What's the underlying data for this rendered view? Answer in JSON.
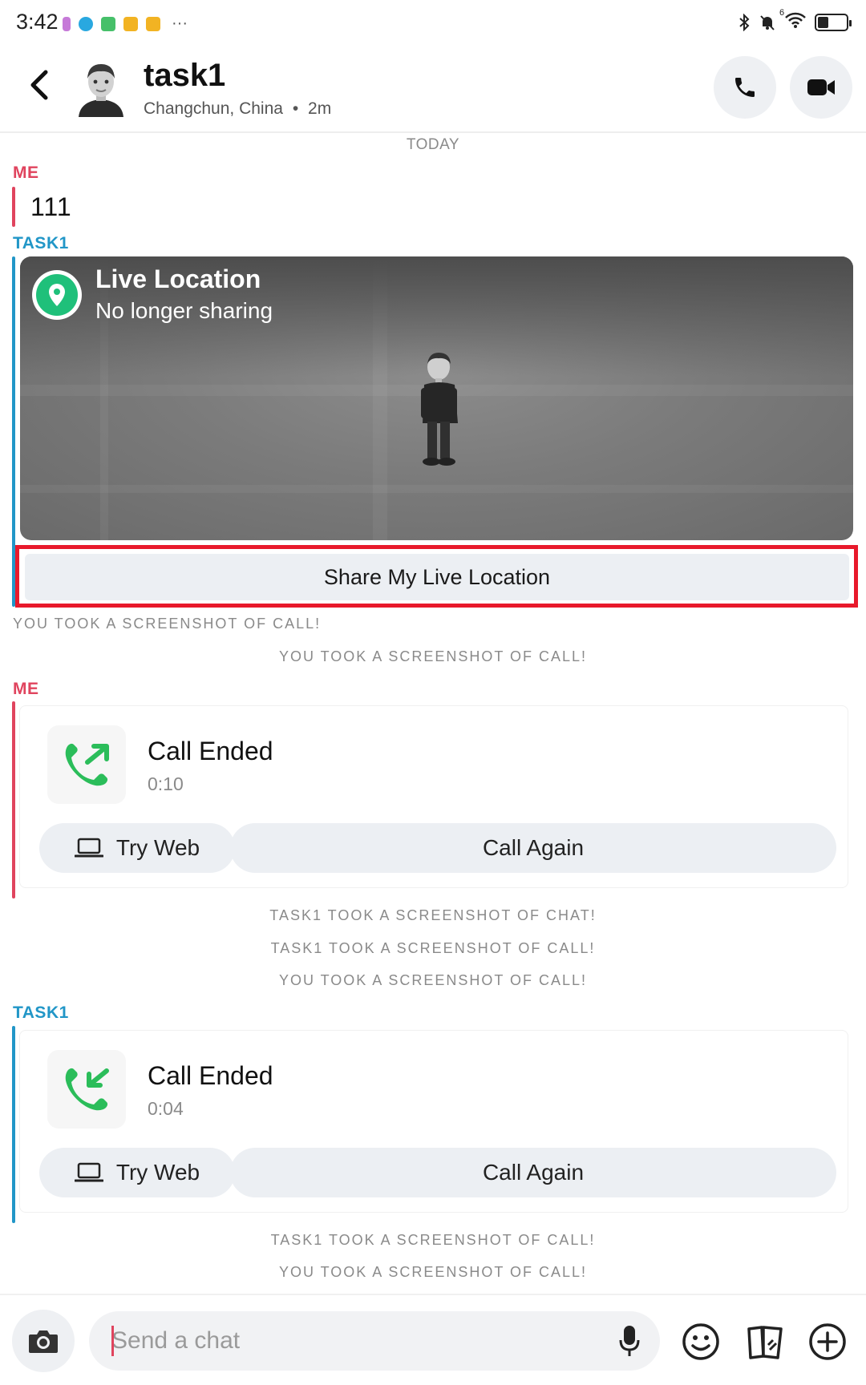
{
  "status_bar": {
    "time": "3:42",
    "more": "···",
    "bluetooth_icon": "bluetooth-icon",
    "mute_icon": "bell-off-icon",
    "wifi_icon": "wifi-icon",
    "wifi_badge": "6",
    "battery_level": 0.4
  },
  "header": {
    "title": "task1",
    "location": "Changchun, China",
    "separator": "•",
    "time_ago": "2m"
  },
  "chat": {
    "date_divider": "TODAY",
    "msg1": {
      "sender": "ME",
      "text": "111"
    },
    "msg2": {
      "sender": "TASK1",
      "live_location_title": "Live Location",
      "live_location_status": "No longer sharing",
      "share_button": "Share My Live Location"
    },
    "sys1": "YOU TOOK A SCREENSHOT OF CALL!",
    "sys2": "YOU TOOK A SCREENSHOT OF CALL!",
    "call1": {
      "sender": "ME",
      "title": "Call Ended",
      "duration": "0:10",
      "try_web": "Try Web",
      "call_again": "Call Again"
    },
    "sys3": "TASK1 TOOK A SCREENSHOT OF CHAT!",
    "sys4": "TASK1 TOOK A SCREENSHOT OF CALL!",
    "sys5": "YOU TOOK A SCREENSHOT OF CALL!",
    "call2": {
      "sender": "TASK1",
      "title": "Call Ended",
      "duration": "0:04",
      "try_web": "Try Web",
      "call_again": "Call Again"
    },
    "sys6": "TASK1 TOOK A SCREENSHOT OF CALL!",
    "sys7": "YOU TOOK A SCREENSHOT OF CALL!"
  },
  "composer": {
    "placeholder": "Send a chat"
  },
  "colors": {
    "me_accent": "#e0445e",
    "them_accent": "#2196c7",
    "location_green": "#1fc07a",
    "call_green": "#2bbd5a",
    "highlight_red": "#e8192b"
  }
}
